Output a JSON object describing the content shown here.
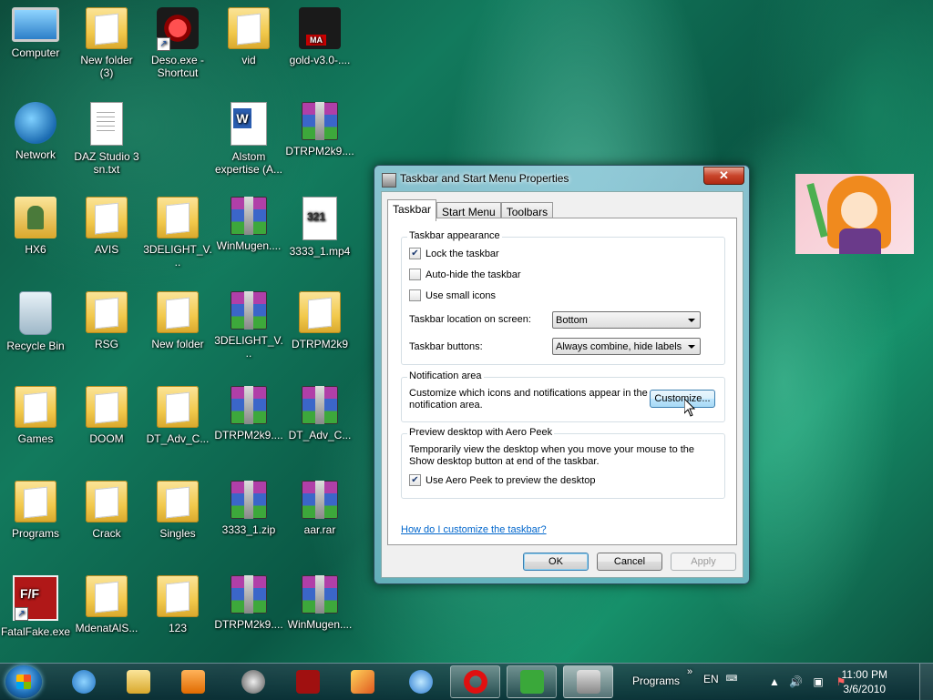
{
  "desktop": {
    "icons": [
      {
        "label": "Computer",
        "icon": "computer-icon"
      },
      {
        "label": "New folder\n(3)",
        "icon": "folder-icon"
      },
      {
        "label": "Deso.exe -\nShortcut",
        "icon": "app-shortcut-icon"
      },
      {
        "label": "vid",
        "icon": "folder-icon"
      },
      {
        "label": "gold-v3.0-....",
        "icon": "app-icon"
      },
      {
        "label": "Network",
        "icon": "network-icon"
      },
      {
        "label": "DAZ Studio 3\nsn.txt",
        "icon": "text-file-icon"
      },
      {
        "label": "Alstom\nexpertise (A...",
        "icon": "word-doc-icon"
      },
      {
        "label": "DTRPM2k9....",
        "icon": "rar-icon"
      },
      {
        "label": "HX6",
        "icon": "user-folder-icon"
      },
      {
        "label": "AVIS",
        "icon": "folder-icon"
      },
      {
        "label": "3DELIGHT_V...",
        "icon": "folder-icon"
      },
      {
        "label": "WinMugen....",
        "icon": "rar-icon"
      },
      {
        "label": "3333_1.mp4",
        "icon": "mp4-file-icon"
      },
      {
        "label": "Recycle Bin",
        "icon": "recycle-bin-icon"
      },
      {
        "label": "RSG",
        "icon": "folder-icon"
      },
      {
        "label": "New folder",
        "icon": "folder-icon"
      },
      {
        "label": "3DELIGHT_V...",
        "icon": "rar-icon"
      },
      {
        "label": "DTRPM2k9",
        "icon": "folder-icon"
      },
      {
        "label": "Games",
        "icon": "folder-icon"
      },
      {
        "label": "DOOM",
        "icon": "folder-icon"
      },
      {
        "label": "DT_Adv_C...",
        "icon": "folder-icon"
      },
      {
        "label": "DTRPM2k9....",
        "icon": "rar-icon"
      },
      {
        "label": "DT_Adv_C...",
        "icon": "rar-icon"
      },
      {
        "label": "Programs",
        "icon": "folder-icon"
      },
      {
        "label": "Crack",
        "icon": "folder-icon"
      },
      {
        "label": "Singles",
        "icon": "folder-icon"
      },
      {
        "label": "3333_1.zip",
        "icon": "rar-icon"
      },
      {
        "label": "aar.rar",
        "icon": "rar-icon"
      },
      {
        "label": "FatalFake.exe",
        "icon": "app-shortcut-icon"
      },
      {
        "label": "MdenatAlS...",
        "icon": "folder-icon"
      },
      {
        "label": "123",
        "icon": "folder-icon"
      },
      {
        "label": "DTRPM2k9....",
        "icon": "rar-icon"
      },
      {
        "label": "WinMugen....",
        "icon": "rar-icon"
      }
    ]
  },
  "dialog": {
    "title": "Taskbar and Start Menu Properties",
    "close_label": "✕",
    "tabs": [
      "Taskbar",
      "Start Menu",
      "Toolbars"
    ],
    "appearance": {
      "group_title": "Taskbar appearance",
      "lock_label": "Lock the taskbar",
      "lock_checked": true,
      "autohide_label": "Auto-hide the taskbar",
      "autohide_checked": false,
      "small_icons_label": "Use small icons",
      "small_icons_checked": false,
      "location_label": "Taskbar location on screen:",
      "location_value": "Bottom",
      "buttons_label": "Taskbar buttons:",
      "buttons_value": "Always combine, hide labels"
    },
    "notification": {
      "group_title": "Notification area",
      "text": "Customize which icons and notifications appear in the notification area.",
      "customize_label": "Customize..."
    },
    "peek": {
      "group_title": "Preview desktop with Aero Peek",
      "text": "Temporarily view the desktop when you move your mouse to the Show desktop button at end of the taskbar.",
      "use_label": "Use Aero Peek to preview the desktop",
      "use_checked": true
    },
    "help_link": "How do I customize the taskbar?",
    "buttons": {
      "ok": "OK",
      "cancel": "Cancel",
      "apply": "Apply"
    }
  },
  "taskbar": {
    "pinned": [
      "internet-explorer-icon",
      "explorer-folder-icon",
      "media-player-icon",
      "satellite-app-icon",
      "red-app-icon",
      "paint-app-icon",
      "ie8-icon",
      "opera-icon",
      "utorrent-icon",
      "taskbar-properties-icon"
    ],
    "programs_label": "Programs",
    "chevron": "»",
    "language": "EN",
    "time": "11:00 PM",
    "date": "3/6/2010"
  },
  "colors": {
    "accent": "#3c7fb1",
    "link": "#0066cc",
    "close_red": "#c8442a"
  }
}
